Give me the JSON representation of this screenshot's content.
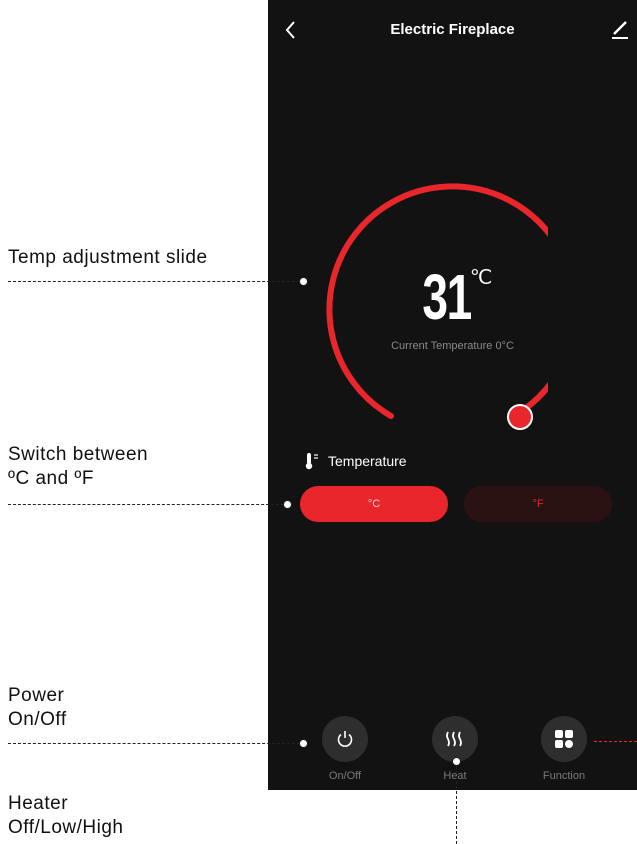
{
  "app": {
    "title": "Electric Fireplace"
  },
  "dial": {
    "value": "31",
    "unit": "℃",
    "current_label": "Current Temperature 0°C",
    "accent": "#e8262b"
  },
  "temperature_section": {
    "label": "Temperature",
    "celsius_label": "°C",
    "fahrenheit_label": "°F",
    "selected": "°C"
  },
  "controls": [
    {
      "label": "On/Off",
      "icon": "power-icon"
    },
    {
      "label": "Heat",
      "icon": "heat-icon"
    },
    {
      "label": "Function",
      "icon": "grid-icon"
    }
  ],
  "annotations": {
    "temp_slide": "Temp adjustment slide",
    "switch_line1": "Switch between",
    "switch_line2": "ºC and ºF",
    "power_line1": "Power",
    "power_line2": "On/Off",
    "heater_line1": "Heater",
    "heater_line2": "Off/Low/High"
  }
}
